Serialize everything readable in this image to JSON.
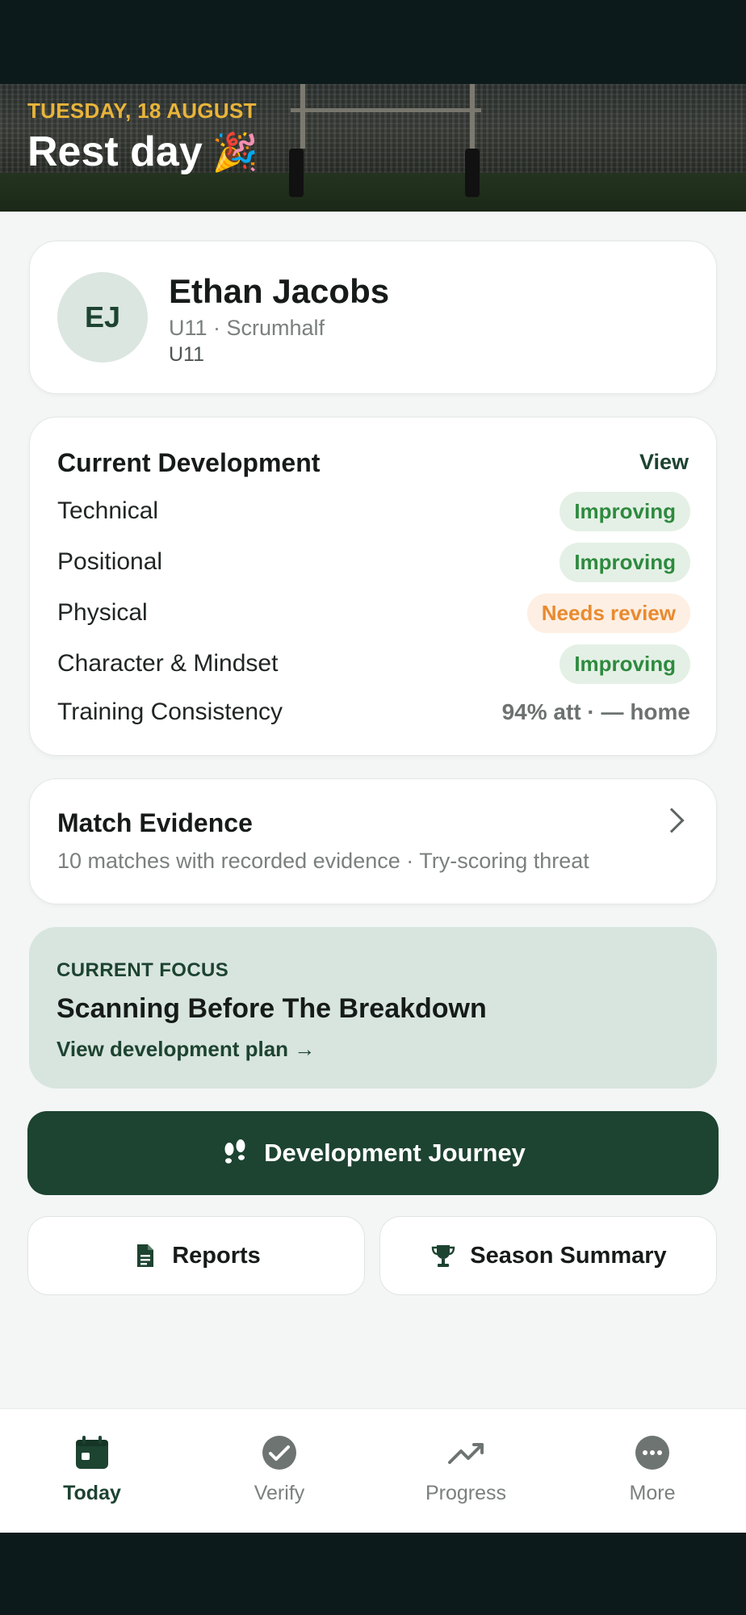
{
  "header": {
    "date": "TUESDAY, 18 AUGUST",
    "title": "Rest day",
    "emoji": "🎉"
  },
  "profile": {
    "initials": "EJ",
    "name": "Ethan Jacobs",
    "line1": "U11 · Scrumhalf",
    "line2": "U11"
  },
  "development": {
    "title": "Current Development",
    "view_label": "View",
    "rows": [
      {
        "label": "Technical",
        "status": "Improving"
      },
      {
        "label": "Positional",
        "status": "Improving"
      },
      {
        "label": "Physical",
        "status": "Needs review"
      },
      {
        "label": "Character & Mindset",
        "status": "Improving"
      }
    ],
    "consistency_label": "Training Consistency",
    "consistency_value": "94% att · — home"
  },
  "match_evidence": {
    "title": "Match Evidence",
    "description": "10 matches with recorded evidence · Try-scoring threat"
  },
  "focus": {
    "kicker": "CURRENT FOCUS",
    "title": "Scanning Before The Breakdown",
    "link": "View development plan →"
  },
  "actions": {
    "journey": "Development Journey",
    "reports": "Reports",
    "season": "Season Summary"
  },
  "tabs": [
    {
      "label": "Today",
      "icon": "calendar-icon"
    },
    {
      "label": "Verify",
      "icon": "check-circle-icon"
    },
    {
      "label": "Progress",
      "icon": "trend-up-icon"
    },
    {
      "label": "More",
      "icon": "more-icon"
    }
  ],
  "colors": {
    "brand_green": "#1d4331",
    "accent_gold": "#e9b43a",
    "improving": "#2e8a3e",
    "needs_review": "#e98a2f"
  }
}
